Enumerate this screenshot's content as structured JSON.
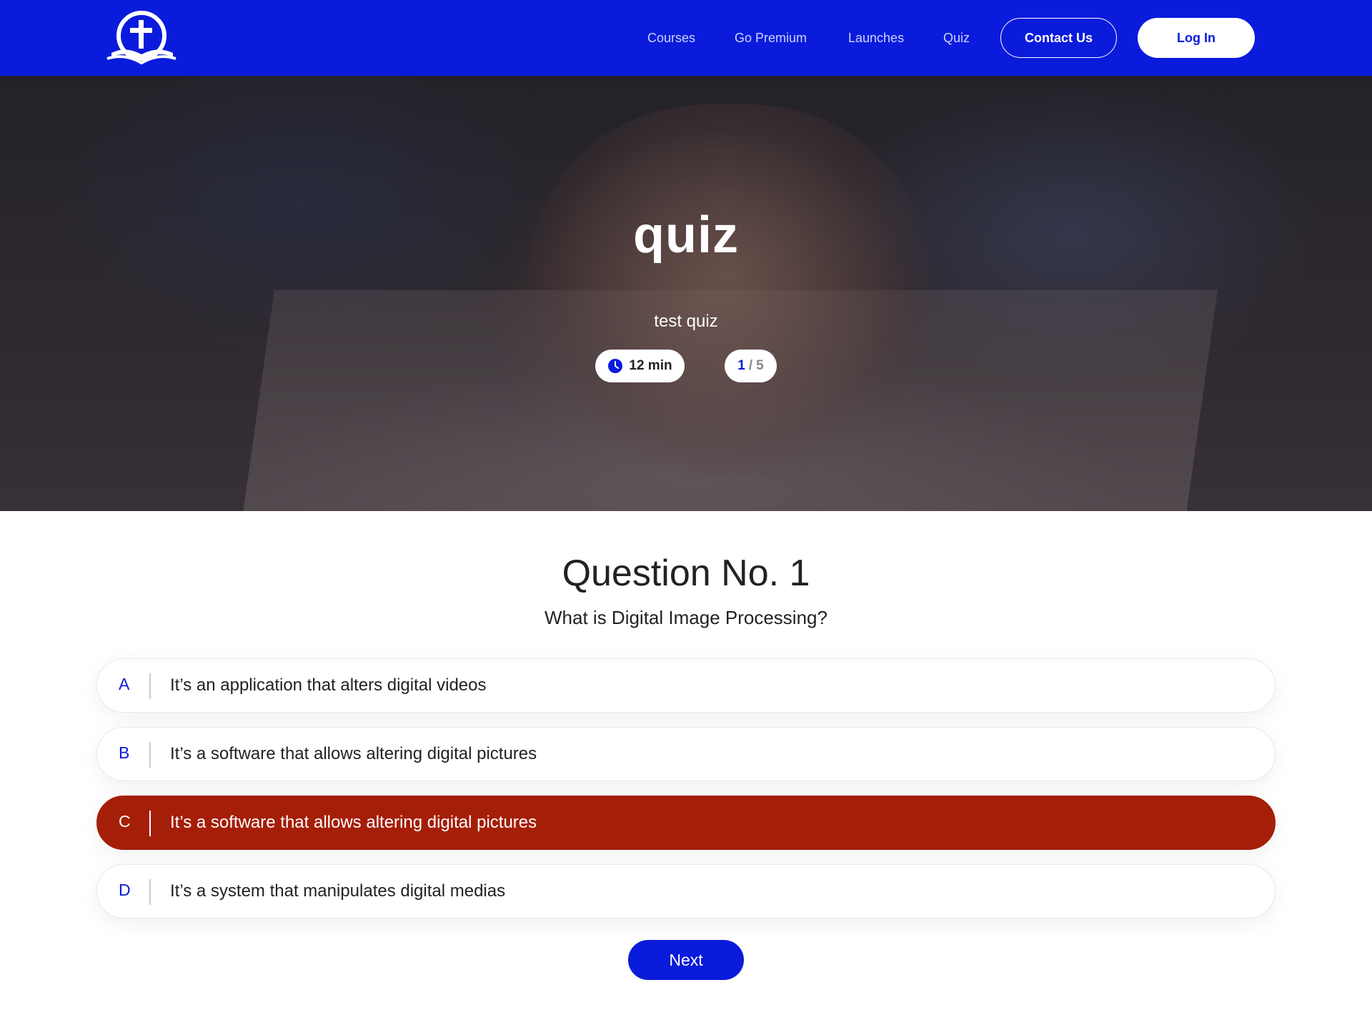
{
  "nav": {
    "links": [
      "Courses",
      "Go Premium",
      "Launches",
      "Quiz"
    ],
    "contact_label": "Contact Us",
    "login_label": "Log In"
  },
  "hero": {
    "title": "quiz",
    "subtitle": "test quiz",
    "time_label": "12 min",
    "progress_current": "1",
    "progress_separator": "/",
    "progress_total": "5"
  },
  "question": {
    "number_label": "Question No. 1",
    "text": "What is Digital Image Processing?",
    "options": [
      {
        "letter": "A",
        "text": "It’s an application that alters digital videos"
      },
      {
        "letter": "B",
        "text": "It’s a software that allows altering digital pictures"
      },
      {
        "letter": "C",
        "text": "It’s a software that allows altering digital pictures"
      },
      {
        "letter": "D",
        "text": "It’s a system that manipulates digital medias"
      }
    ],
    "selected_option": "C"
  },
  "next_label": "Next",
  "icons": {
    "logo": "bible-cross-logo-icon",
    "time": "clock-icon"
  },
  "colors": {
    "brand": "#0a1bdc",
    "selected": "#a51e08"
  }
}
